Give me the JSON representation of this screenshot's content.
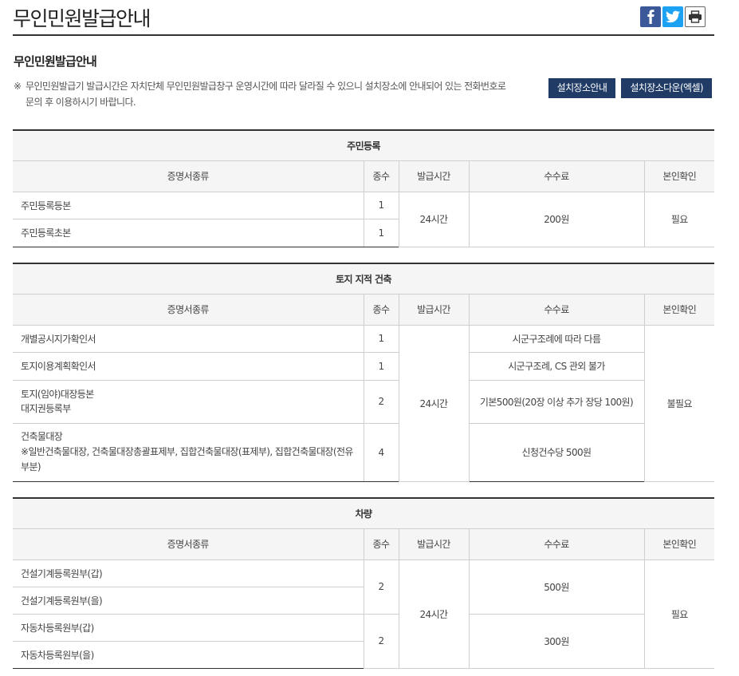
{
  "page": {
    "title": "무인민원발급안내",
    "share": {
      "facebook_icon": "facebook-icon",
      "twitter_icon": "twitter-icon",
      "print_icon": "print-icon"
    }
  },
  "guide": {
    "subtitle": "무인민원발급안내",
    "notice_mark": "※",
    "notice_text": "무인민원발급기 발급시간은 자치단체 무인민원발급창구 운영시간에 따라 달라질 수 있으니 설치장소에 안내되어 있는 전화번호로 문의 후 이용하시기 바랍니다.",
    "location_button": "설치장소안내",
    "download_button": "설치장소다운(엑셀)"
  },
  "columns": {
    "doc_type": "증명서종류",
    "count": "종수",
    "hours": "발급시간",
    "fee": "수수료",
    "identity": "본인확인"
  },
  "tables": {
    "resident": {
      "caption": "주민등록",
      "rows": [
        {
          "doc": "주민등록등본",
          "count": "1"
        },
        {
          "doc": "주민등록초본",
          "count": "1"
        }
      ],
      "hours": "24시간",
      "fee": "200원",
      "identity": "필요"
    },
    "land": {
      "caption": "토지 지적 건축",
      "rows": [
        {
          "doc_lines": [
            "개별공시지가확인서"
          ],
          "count": "1",
          "fee": "시군구조례에 따라 다름"
        },
        {
          "doc_lines": [
            "토지이용계획확인서"
          ],
          "count": "1",
          "fee": "시군구조례, CS 관외 불가"
        },
        {
          "doc_lines": [
            "토지(임야)대장등본",
            "대지권등록부"
          ],
          "count": "2",
          "fee": "기본500원(20장 이상 추가 장당 100원)"
        },
        {
          "doc_lines": [
            "건축물대장",
            "※일반건축물대장, 건축물대장총괄표제부, 집합건축물대장(표제부), 집합건축물대장(전유부분)"
          ],
          "count": "4",
          "fee": "신청건수당 500원"
        }
      ],
      "hours": "24시간",
      "identity": "불필요"
    },
    "vehicle": {
      "caption": "차량",
      "rows": [
        {
          "doc": "건설기계등록원부(갑)"
        },
        {
          "doc": "건설기계등록원부(을)"
        },
        {
          "doc": "자동차등록원부(갑)"
        },
        {
          "doc": "자동차등록원부(을)"
        }
      ],
      "group1": {
        "count": "2",
        "fee": "500원"
      },
      "group2": {
        "count": "2",
        "fee": "300원"
      },
      "hours": "24시간",
      "identity": "필요"
    }
  },
  "colors": {
    "button_bg": "#1f3b66",
    "header_bg": "#f5f5f5",
    "facebook": "#3b5998",
    "twitter": "#1da1f2"
  }
}
